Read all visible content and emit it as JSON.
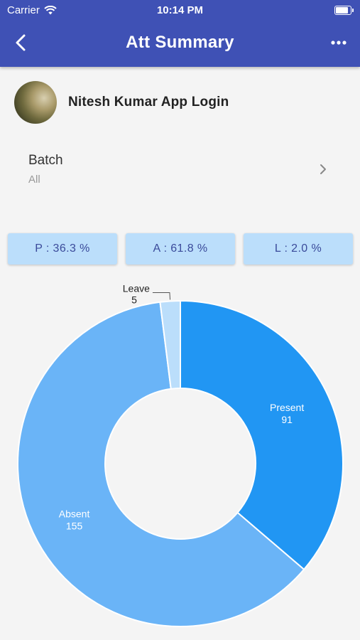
{
  "status_bar": {
    "carrier": "Carrier",
    "time": "10:14 PM"
  },
  "app_bar": {
    "title": "Att Summary",
    "back_icon": "chevron-left-icon",
    "more_icon": "more-horizontal-icon",
    "color": "#3f51b5"
  },
  "profile": {
    "name": "Nitesh Kumar App Login"
  },
  "batch": {
    "label": "Batch",
    "value": "All"
  },
  "stats": [
    {
      "label": "P : 36.3 %"
    },
    {
      "label": "A : 61.8 %"
    },
    {
      "label": "L : 2.0 %"
    }
  ],
  "chart_data": {
    "type": "pie",
    "donut": true,
    "categories": [
      "Present",
      "Absent",
      "Leave"
    ],
    "values": [
      91,
      155,
      5
    ],
    "colors": [
      "#2196f3",
      "#6ab4f7",
      "#bbdefb"
    ]
  }
}
